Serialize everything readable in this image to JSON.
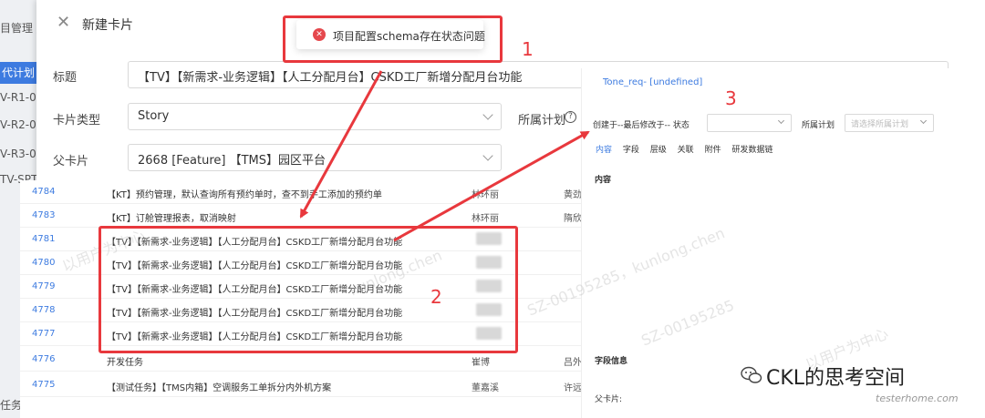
{
  "background": {
    "items": [
      {
        "label": "目管理 /",
        "active": false
      },
      {
        "label": "代计划",
        "active": true
      },
      {
        "label": "V-R1-0",
        "active": false
      },
      {
        "label": "V-R2-0",
        "active": false
      },
      {
        "label": "V-R3-0",
        "active": false
      },
      {
        "label": "TV-SPT",
        "active": false
      },
      {
        "label": "任务项",
        "active": false
      }
    ]
  },
  "modal": {
    "title": "新建卡片",
    "fields": {
      "title_label": "标题",
      "title_value": "【TV】【新需求-业务逻辑】【人工分配月台】CSKD工厂新增分配月台功能",
      "type_label": "卡片类型",
      "type_value": "Story",
      "plan_label": "所属计划",
      "parent_label": "父卡片",
      "parent_value": "2668 [Feature] 【TMS】园区平台"
    }
  },
  "toast": {
    "message": "项目配置schema存在状态问题"
  },
  "annotations": {
    "one": "1",
    "two": "2",
    "three": "3"
  },
  "table": {
    "rows": [
      {
        "id": "4784",
        "title": "【KT】预约管理，默认查询所有预约单时，查不到手工添加的预约单",
        "owner": "林环丽",
        "extra": "黄劲"
      },
      {
        "id": "4783",
        "title": "【KT】订舱管理报表，取消映射",
        "owner": "林环丽",
        "extra": "隋欣"
      },
      {
        "id": "4781",
        "title": "【TV】【新需求-业务逻辑】【人工分配月台】CSKD工厂新增分配月台功能",
        "owner": "",
        "extra": ""
      },
      {
        "id": "4780",
        "title": "【TV】【新需求-业务逻辑】【人工分配月台】CSKD工厂新增分配月台功能",
        "owner": "",
        "extra": ""
      },
      {
        "id": "4779",
        "title": "【TV】【新需求-业务逻辑】【人工分配月台】CSKD工厂新增分配月台功能",
        "owner": "",
        "extra": ""
      },
      {
        "id": "4778",
        "title": "【TV】【新需求-业务逻辑】【人工分配月台】CSKD工厂新增分配月台功能",
        "owner": "",
        "extra": ""
      },
      {
        "id": "4777",
        "title": "【TV】【新需求-业务逻辑】【人工分配月台】CSKD工厂新增分配月台功能",
        "owner": "",
        "extra": ""
      },
      {
        "id": "4776",
        "title": "开发任务",
        "owner": "崔博",
        "extra": "吕外"
      },
      {
        "id": "4775",
        "title": "【测试任务】【TMS内箱】空调服务工单拆分内外机方案",
        "owner": "董嘉溪",
        "extra": "许远"
      }
    ]
  },
  "right_panel": {
    "title": "Tone_req- [undefined]",
    "meta": "创建于--最后修改于-- 状态",
    "plan_label": "所属计划",
    "plan_placeholder": "请选择所属计划",
    "tabs": [
      "内容",
      "字段",
      "层级",
      "关联",
      "附件",
      "研发数据链"
    ],
    "section_content": "内容",
    "section_fields": "字段信息",
    "section_parent": "父卡片:"
  },
  "watermarks": [
    "以用户为中心",
    "kunlong.chen",
    "SZ-00195285",
    "以用户为中心",
    "SZ-00195285，kunlong.chen"
  ],
  "brand": {
    "name": "CKL的思考空间",
    "sub": "testerhome.com"
  },
  "colors": {
    "accent": "#3d7be0",
    "error": "#e5484d",
    "annotation": "#e8383d"
  }
}
